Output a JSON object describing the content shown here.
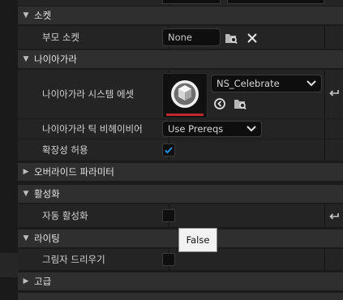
{
  "sections": {
    "socket": {
      "title": "소켓",
      "parent_socket_label": "부모 소켓",
      "parent_socket_value": "None"
    },
    "niagara": {
      "title": "나이아가라",
      "system_asset_label": "나이아가라 시스템 에셋",
      "asset_name": "NS_Celebrate",
      "tick_behavior_label": "나이아가라 틱 비헤이비어",
      "tick_behavior_value": "Use Prereqs",
      "scalability_label": "확장성 허용",
      "scalability_checked": true
    },
    "override_parameters": {
      "title": "오버라이드 파라미터"
    },
    "activation": {
      "title": "활성화",
      "auto_activate_label": "자동 활성화",
      "auto_activate_checked": false
    },
    "tooltip": "False",
    "lighting": {
      "title": "라이팅",
      "cast_shadow_label": "그림자 드리우기",
      "cast_shadow_checked": false
    },
    "advanced": {
      "title": "고급"
    }
  },
  "colors": {
    "accent": "#1f8fe0",
    "thumbnail_underline": "#c0282e",
    "tooltip_bg": "#f2f2f2"
  },
  "icons": [
    "collapse-arrow-icon",
    "expand-arrow-icon",
    "browse-asset-icon",
    "clear-x-icon",
    "use-selected-icon",
    "reset-arrow-icon",
    "chevron-down-icon",
    "checkmark-icon"
  ]
}
